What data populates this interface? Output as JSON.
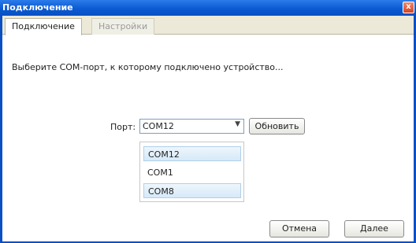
{
  "window": {
    "title": "Подключение",
    "close_label": "x"
  },
  "tabs": [
    {
      "label": "Подключение",
      "active": true
    },
    {
      "label": "Настройки",
      "active": false
    }
  ],
  "main": {
    "prompt": "Выберите COM-порт, к которому подключено устройство...",
    "port_label": "Порт:",
    "port_value": "COM12",
    "refresh_label": "Обновить",
    "dropdown_options": [
      "COM12",
      "COM1",
      "COM8"
    ]
  },
  "footer": {
    "cancel_label": "Отмена",
    "next_label": "Далее"
  },
  "colors": {
    "titlebar": "#0a58d0",
    "highlight": "#d6e9f8"
  }
}
